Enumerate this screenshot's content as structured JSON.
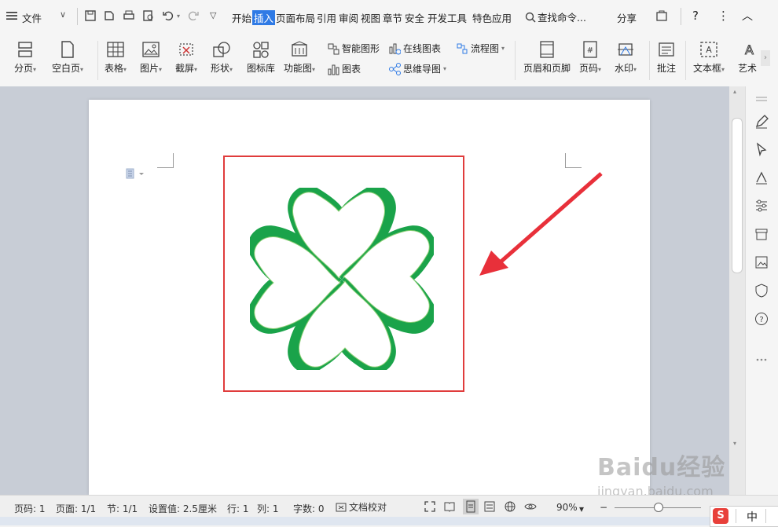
{
  "menubar": {
    "file_label": "文件",
    "tabs": [
      "开始",
      "插入",
      "页面布局",
      "引用",
      "审阅",
      "视图",
      "章节",
      "安全",
      "开发工具",
      "特色应用"
    ],
    "active_tab": "插入",
    "search_label": "查找命令...",
    "share_label": "分享",
    "help": "?",
    "more": "⋮"
  },
  "ribbon": {
    "page_break": "分页",
    "blank_page": "空白页",
    "table": "表格",
    "picture": "图片",
    "screenshot": "截屏",
    "shape": "形状",
    "icon_library": "图标库",
    "function_chart": "功能图",
    "smart_shape": "智能图形",
    "chart": "图表",
    "online_chart": "在线图表",
    "mind_map": "思维导图",
    "flowchart": "流程图",
    "header_footer": "页眉和页脚",
    "page_number": "页码",
    "watermark": "水印",
    "comment": "批注",
    "textbox": "文本框",
    "art_text": "艺术"
  },
  "status": {
    "page_code": "页码: 1",
    "pages": "页面: 1/1",
    "section": "节: 1/1",
    "setting": "设置值: 2.5厘米",
    "row": "行: 1",
    "col": "列: 1",
    "word_count": "字数: 0",
    "proofread": "文档校对",
    "zoom": "90%"
  },
  "ime": {
    "lang": "中"
  },
  "watermark": {
    "line1": "Baidu经验",
    "line2": "jingyan.baidu.com"
  },
  "colors": {
    "accent": "#2f7ae5",
    "clover": "#1aa34a",
    "highlight_box": "#e03c3c",
    "arrow": "#e8303a"
  }
}
